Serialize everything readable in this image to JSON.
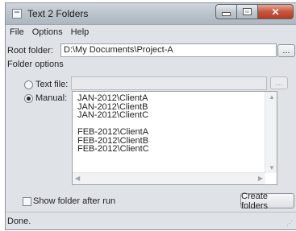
{
  "window": {
    "title": "Text 2 Folders"
  },
  "menu": {
    "items": [
      "File",
      "Options",
      "Help"
    ]
  },
  "root_folder": {
    "label": "Root folder:",
    "value": "D:\\My Documents\\Project-A",
    "browse_label": "..."
  },
  "folder_options": {
    "heading": "Folder options",
    "text_file": {
      "label": "Text file:",
      "value": "",
      "browse_label": "...",
      "selected": false
    },
    "manual": {
      "label": "Manual:",
      "selected": true,
      "lines": [
        "JAN-2012\\ClientA",
        "JAN-2012\\ClientB",
        "JAN-2012\\ClientC",
        "",
        "FEB-2012\\ClientA",
        "FEB-2012\\ClientB",
        "FEB-2012\\ClientC"
      ]
    }
  },
  "show_folder_after_run": {
    "label": "Show folder after run",
    "checked": false
  },
  "create_button": {
    "label": "Create folders"
  },
  "status": {
    "text": "Done."
  }
}
